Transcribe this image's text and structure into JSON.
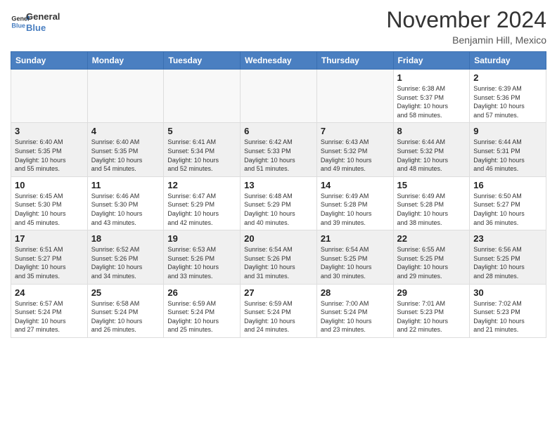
{
  "logo": {
    "line1": "General",
    "line2": "Blue"
  },
  "header": {
    "month": "November 2024",
    "location": "Benjamin Hill, Mexico"
  },
  "weekdays": [
    "Sunday",
    "Monday",
    "Tuesday",
    "Wednesday",
    "Thursday",
    "Friday",
    "Saturday"
  ],
  "weeks": [
    [
      {
        "day": "",
        "info": ""
      },
      {
        "day": "",
        "info": ""
      },
      {
        "day": "",
        "info": ""
      },
      {
        "day": "",
        "info": ""
      },
      {
        "day": "",
        "info": ""
      },
      {
        "day": "1",
        "info": "Sunrise: 6:38 AM\nSunset: 5:37 PM\nDaylight: 10 hours\nand 58 minutes."
      },
      {
        "day": "2",
        "info": "Sunrise: 6:39 AM\nSunset: 5:36 PM\nDaylight: 10 hours\nand 57 minutes."
      }
    ],
    [
      {
        "day": "3",
        "info": "Sunrise: 6:40 AM\nSunset: 5:35 PM\nDaylight: 10 hours\nand 55 minutes."
      },
      {
        "day": "4",
        "info": "Sunrise: 6:40 AM\nSunset: 5:35 PM\nDaylight: 10 hours\nand 54 minutes."
      },
      {
        "day": "5",
        "info": "Sunrise: 6:41 AM\nSunset: 5:34 PM\nDaylight: 10 hours\nand 52 minutes."
      },
      {
        "day": "6",
        "info": "Sunrise: 6:42 AM\nSunset: 5:33 PM\nDaylight: 10 hours\nand 51 minutes."
      },
      {
        "day": "7",
        "info": "Sunrise: 6:43 AM\nSunset: 5:32 PM\nDaylight: 10 hours\nand 49 minutes."
      },
      {
        "day": "8",
        "info": "Sunrise: 6:44 AM\nSunset: 5:32 PM\nDaylight: 10 hours\nand 48 minutes."
      },
      {
        "day": "9",
        "info": "Sunrise: 6:44 AM\nSunset: 5:31 PM\nDaylight: 10 hours\nand 46 minutes."
      }
    ],
    [
      {
        "day": "10",
        "info": "Sunrise: 6:45 AM\nSunset: 5:30 PM\nDaylight: 10 hours\nand 45 minutes."
      },
      {
        "day": "11",
        "info": "Sunrise: 6:46 AM\nSunset: 5:30 PM\nDaylight: 10 hours\nand 43 minutes."
      },
      {
        "day": "12",
        "info": "Sunrise: 6:47 AM\nSunset: 5:29 PM\nDaylight: 10 hours\nand 42 minutes."
      },
      {
        "day": "13",
        "info": "Sunrise: 6:48 AM\nSunset: 5:29 PM\nDaylight: 10 hours\nand 40 minutes."
      },
      {
        "day": "14",
        "info": "Sunrise: 6:49 AM\nSunset: 5:28 PM\nDaylight: 10 hours\nand 39 minutes."
      },
      {
        "day": "15",
        "info": "Sunrise: 6:49 AM\nSunset: 5:28 PM\nDaylight: 10 hours\nand 38 minutes."
      },
      {
        "day": "16",
        "info": "Sunrise: 6:50 AM\nSunset: 5:27 PM\nDaylight: 10 hours\nand 36 minutes."
      }
    ],
    [
      {
        "day": "17",
        "info": "Sunrise: 6:51 AM\nSunset: 5:27 PM\nDaylight: 10 hours\nand 35 minutes."
      },
      {
        "day": "18",
        "info": "Sunrise: 6:52 AM\nSunset: 5:26 PM\nDaylight: 10 hours\nand 34 minutes."
      },
      {
        "day": "19",
        "info": "Sunrise: 6:53 AM\nSunset: 5:26 PM\nDaylight: 10 hours\nand 33 minutes."
      },
      {
        "day": "20",
        "info": "Sunrise: 6:54 AM\nSunset: 5:26 PM\nDaylight: 10 hours\nand 31 minutes."
      },
      {
        "day": "21",
        "info": "Sunrise: 6:54 AM\nSunset: 5:25 PM\nDaylight: 10 hours\nand 30 minutes."
      },
      {
        "day": "22",
        "info": "Sunrise: 6:55 AM\nSunset: 5:25 PM\nDaylight: 10 hours\nand 29 minutes."
      },
      {
        "day": "23",
        "info": "Sunrise: 6:56 AM\nSunset: 5:25 PM\nDaylight: 10 hours\nand 28 minutes."
      }
    ],
    [
      {
        "day": "24",
        "info": "Sunrise: 6:57 AM\nSunset: 5:24 PM\nDaylight: 10 hours\nand 27 minutes."
      },
      {
        "day": "25",
        "info": "Sunrise: 6:58 AM\nSunset: 5:24 PM\nDaylight: 10 hours\nand 26 minutes."
      },
      {
        "day": "26",
        "info": "Sunrise: 6:59 AM\nSunset: 5:24 PM\nDaylight: 10 hours\nand 25 minutes."
      },
      {
        "day": "27",
        "info": "Sunrise: 6:59 AM\nSunset: 5:24 PM\nDaylight: 10 hours\nand 24 minutes."
      },
      {
        "day": "28",
        "info": "Sunrise: 7:00 AM\nSunset: 5:24 PM\nDaylight: 10 hours\nand 23 minutes."
      },
      {
        "day": "29",
        "info": "Sunrise: 7:01 AM\nSunset: 5:23 PM\nDaylight: 10 hours\nand 22 minutes."
      },
      {
        "day": "30",
        "info": "Sunrise: 7:02 AM\nSunset: 5:23 PM\nDaylight: 10 hours\nand 21 minutes."
      }
    ]
  ]
}
